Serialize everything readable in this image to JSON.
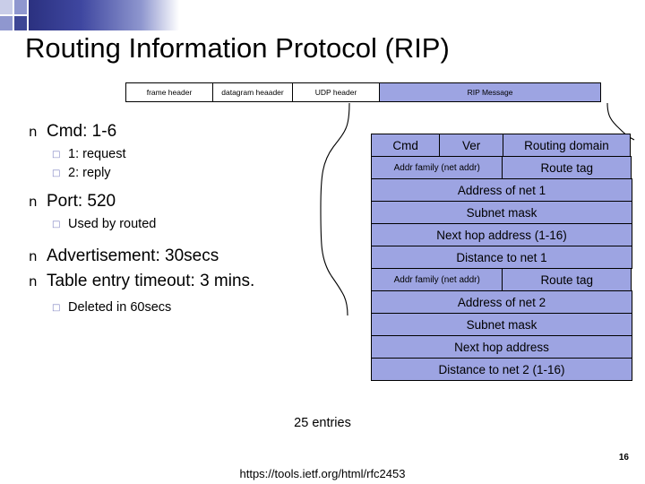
{
  "slide": {
    "title": "Routing Information Protocol (RIP)",
    "page_number": "16",
    "footer_url": "https://tools.ietf.org/html/rfc2453",
    "entries_label": "25 entries"
  },
  "header_strip": [
    {
      "label": "frame header"
    },
    {
      "label": "datagram heaader"
    },
    {
      "label": "UDP header"
    },
    {
      "label": "RIP Message"
    }
  ],
  "bullets": [
    {
      "level": 1,
      "marker": "n",
      "text": "Cmd: 1-6",
      "children": [
        {
          "level": 2,
          "marker": "□",
          "text": "1: request"
        },
        {
          "level": 2,
          "marker": "□",
          "text": "2: reply"
        }
      ]
    },
    {
      "level": 1,
      "marker": "n",
      "text": "Port: 520",
      "children": [
        {
          "level": 2,
          "marker": "□",
          "text": "Used by routed"
        }
      ]
    },
    {
      "level": 1,
      "marker": "n",
      "text": "Advertisement: 30secs",
      "children": []
    },
    {
      "level": 1,
      "marker": "n",
      "text": "Table entry timeout: 3 mins.",
      "children": [
        {
          "level": 2,
          "marker": "□",
          "text": "Deleted in 60secs"
        }
      ]
    }
  ],
  "rip_message_rows": [
    {
      "cells": [
        {
          "text": "Cmd"
        },
        {
          "text": "Ver"
        },
        {
          "text": "Routing domain"
        }
      ]
    },
    {
      "cells": [
        {
          "text": "Addr family (net addr)",
          "small": true
        },
        {
          "text": "Route tag"
        }
      ]
    },
    {
      "cells": [
        {
          "text": "Address of net 1"
        }
      ]
    },
    {
      "cells": [
        {
          "text": "Subnet mask"
        }
      ]
    },
    {
      "cells": [
        {
          "text": "Next hop address (1-16)"
        }
      ]
    },
    {
      "cells": [
        {
          "text": "Distance to net 1"
        }
      ]
    },
    {
      "cells": [
        {
          "text": "Addr family (net addr)",
          "small": true
        },
        {
          "text": "Route tag"
        }
      ]
    },
    {
      "cells": [
        {
          "text": "Address of net 2"
        }
      ]
    },
    {
      "cells": [
        {
          "text": "Subnet mask"
        }
      ]
    },
    {
      "cells": [
        {
          "text": "Next hop address"
        }
      ]
    },
    {
      "cells": [
        {
          "text": "Distance to net 2 (1-16)"
        }
      ]
    }
  ],
  "colors": {
    "table_fill": "#9da4e2",
    "deco_dark": "#3d4695",
    "deco_mid": "#8f97cf",
    "deco_light": "#c9cde8",
    "bullet_lvl2": "#7b7fc0"
  }
}
